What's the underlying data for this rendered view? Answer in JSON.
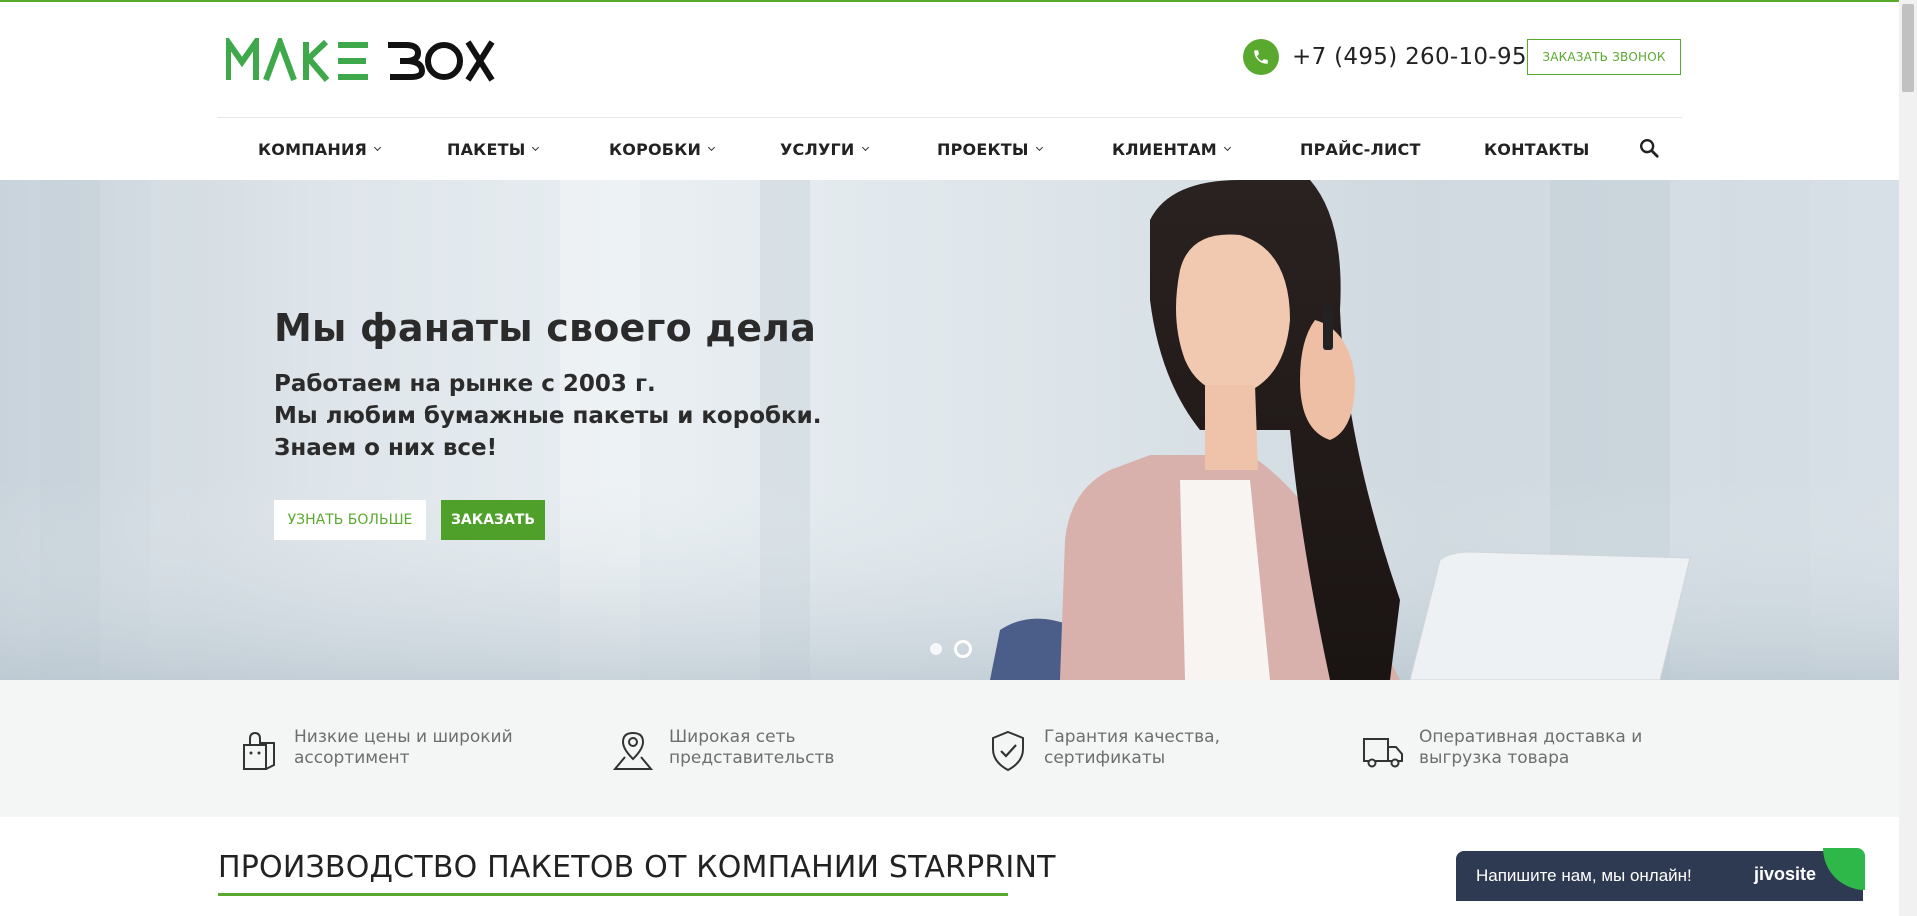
{
  "header": {
    "logo_text": "MAKE BOX",
    "phone": "+7 (495) 260-10-95",
    "callback_label": "ЗАКАЗАТЬ ЗВОНОК"
  },
  "nav": {
    "items": [
      {
        "label": "КОМПАНИЯ",
        "dropdown": true
      },
      {
        "label": "ПАКЕТЫ",
        "dropdown": true
      },
      {
        "label": "КОРОБКИ",
        "dropdown": true
      },
      {
        "label": "УСЛУГИ",
        "dropdown": true
      },
      {
        "label": "ПРОЕКТЫ",
        "dropdown": true
      },
      {
        "label": "КЛИЕНТАМ",
        "dropdown": true
      },
      {
        "label": "ПРАЙС-ЛИСТ",
        "dropdown": false
      },
      {
        "label": "КОНТАКТЫ",
        "dropdown": false
      }
    ],
    "search_icon": "search-icon"
  },
  "hero": {
    "title": "Мы фанаты своего дела",
    "lines": [
      "Работаем на рынке с 2003 г.",
      "Мы любим бумажные пакеты и коробки.",
      "Знаем о них все!"
    ],
    "more_label": "УЗНАТЬ БОЛЬШЕ",
    "order_label": "ЗАКАЗАТЬ",
    "slides_total": 2,
    "active_slide": 2
  },
  "features": [
    {
      "icon": "shopping-bag-icon",
      "line1": "Низкие цены и широкий",
      "line2": "ассортимент"
    },
    {
      "icon": "map-pin-icon",
      "line1": "Широкая сеть",
      "line2": "представительств"
    },
    {
      "icon": "shield-check-icon",
      "line1": "Гарантия качества,",
      "line2": "сертификаты"
    },
    {
      "icon": "truck-icon",
      "line1": "Оперативная доставка и",
      "line2": "выгрузка товара"
    }
  ],
  "section": {
    "title": "ПРОИЗВОДСТВО ПАКЕТОВ ОТ КОМПАНИИ STARPRINT"
  },
  "chat": {
    "text": "Напишите нам, мы онлайн!",
    "brand": "jivosite"
  },
  "colors": {
    "accent": "#5aa92f",
    "chat_bg": "#2e3a52",
    "feature_bg": "#f4f6f5"
  }
}
